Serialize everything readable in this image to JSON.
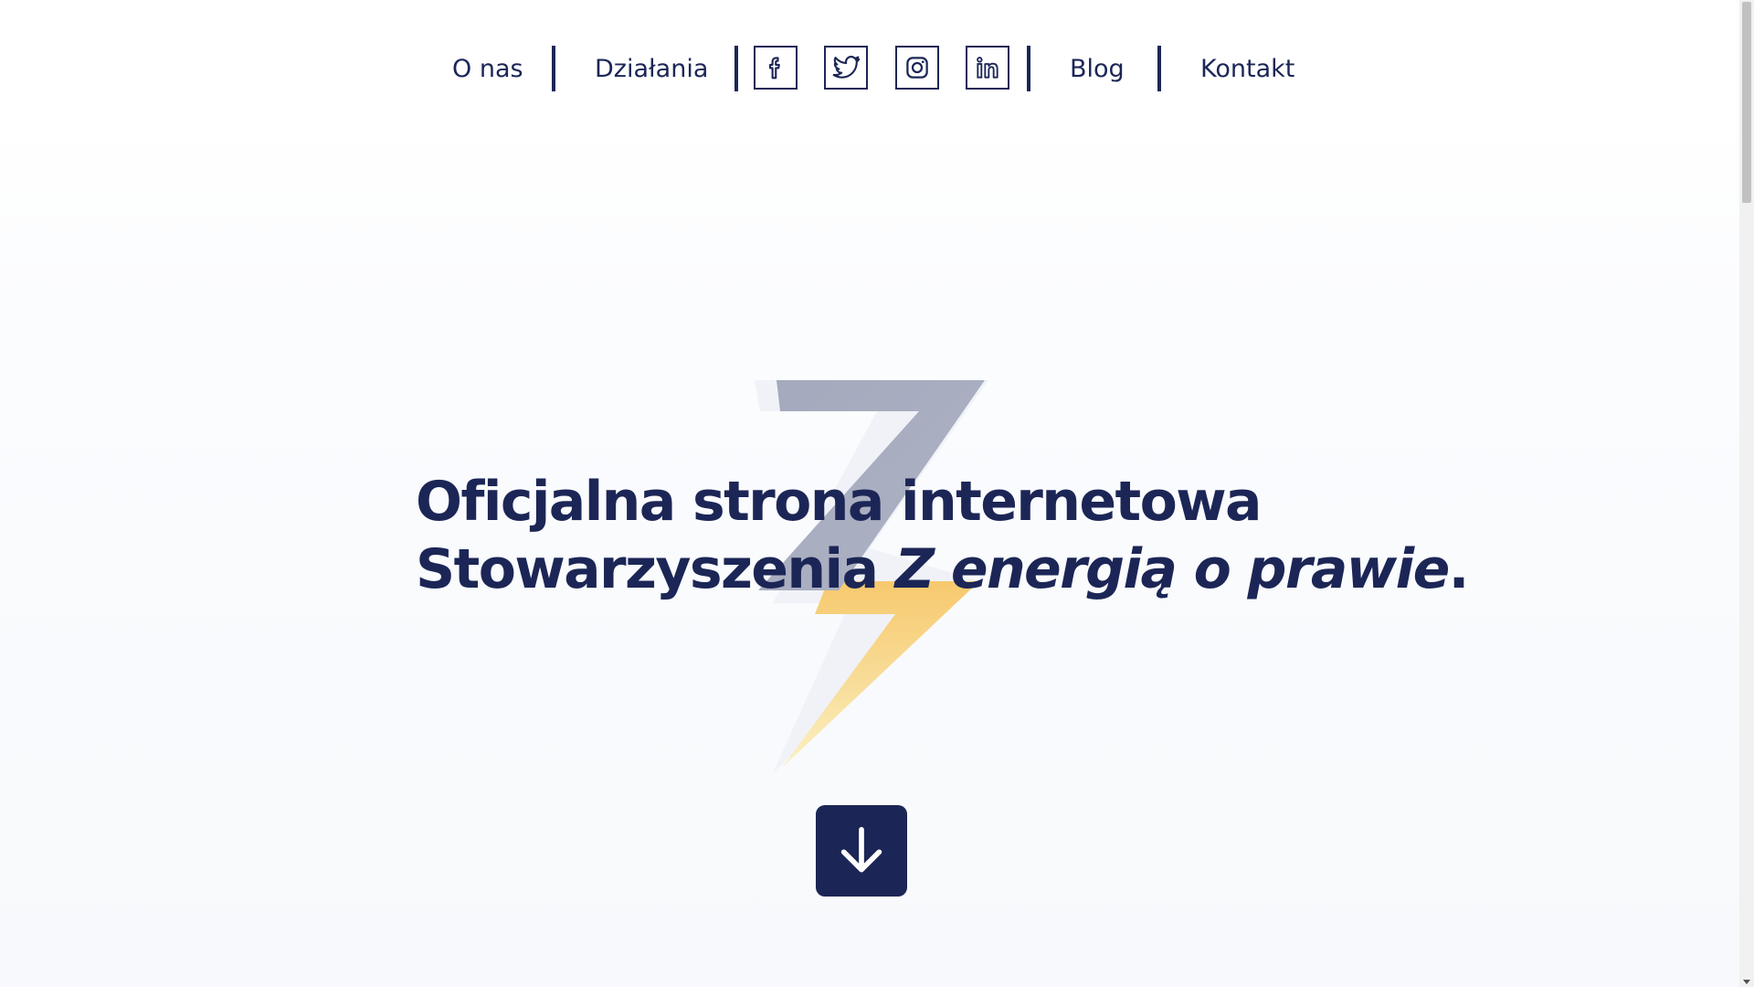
{
  "nav": {
    "items": [
      {
        "label": "O nas"
      },
      {
        "label": "Działania"
      },
      {
        "label": "Blog"
      },
      {
        "label": "Kontakt"
      }
    ],
    "social": [
      {
        "name": "facebook-icon"
      },
      {
        "name": "twitter-icon"
      },
      {
        "name": "instagram-icon"
      },
      {
        "name": "linkedin-icon"
      }
    ]
  },
  "hero": {
    "line1": "Oficjalna strona internetowa",
    "line2_prefix": "Stowarzyszenia ",
    "brand": "Z energią o prawie",
    "line2_suffix": "."
  },
  "icons": {
    "decoration": "lightning-bolt-icon",
    "scroll_button": "arrow-down-icon"
  },
  "colors": {
    "primary": "#1c2656",
    "bolt_grey": "#a9adc0",
    "bolt_yellow": "#f9e2a6"
  }
}
